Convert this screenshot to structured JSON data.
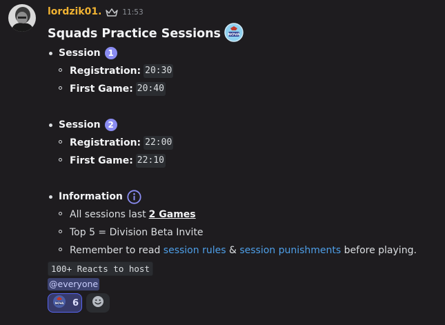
{
  "message": {
    "username": "lordzik01.",
    "timestamp": "11:53",
    "title": "Squads Practice Sessions",
    "sessions": [
      {
        "label": "Session",
        "number": "1",
        "items": [
          {
            "label": "Registration:",
            "value": "20:30"
          },
          {
            "label": "First Game:",
            "value": "20:40"
          }
        ]
      },
      {
        "label": "Session",
        "number": "2",
        "items": [
          {
            "label": "Registration:",
            "value": "22:00"
          },
          {
            "label": "First Game:",
            "value": "22:10"
          }
        ]
      }
    ],
    "information": {
      "label": "Information",
      "line1_prefix": "All sessions last ",
      "line1_emphasis": "2 Games",
      "line2": "Top 5 = Division Beta Invite",
      "line3_prefix": "Remember to read ",
      "link1": "session rules",
      "line3_and": " & ",
      "link2": "session punishments",
      "line3_suffix": " before playing."
    },
    "code_note": "100+ Reacts to host",
    "mention": "@everyone",
    "reaction": {
      "emoji": "nova-emoji",
      "count": "6"
    },
    "add_reaction_icon": "smiley-icon"
  },
  "colors": {
    "background": "#1e1c1f",
    "username": "#f0b232",
    "link": "#4e9fe8",
    "badge": "#8a8cf2",
    "mention_bg": "#3c4270",
    "reaction_active_border": "#5865f2"
  }
}
